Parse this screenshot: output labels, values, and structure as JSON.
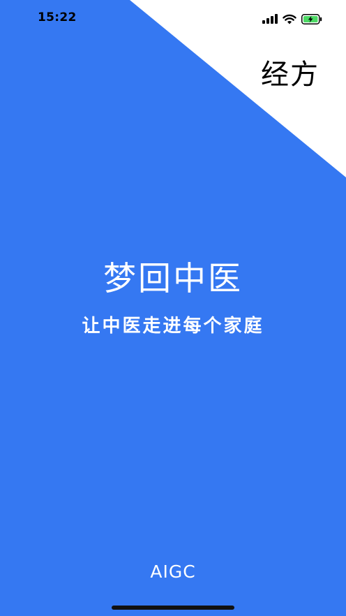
{
  "status_bar": {
    "time": "15:22",
    "signal_icon": "cellular-signal-icon",
    "wifi_icon": "wifi-icon",
    "battery_icon": "battery-charging-icon"
  },
  "splash": {
    "corner_label": "经方",
    "title": "梦回中医",
    "slogan": "让中医走进每个家庭",
    "footer": "AIGC"
  },
  "colors": {
    "background": "#3578f2",
    "corner": "#ffffff",
    "text": "#ffffff",
    "battery_fill": "#4cd964"
  }
}
